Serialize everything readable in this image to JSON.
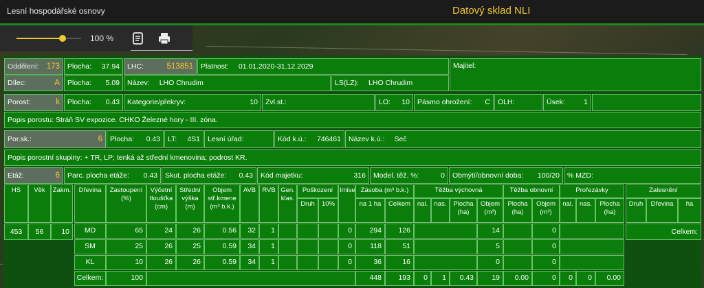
{
  "header": {
    "app_name": "Lesní hospodářské osnovy",
    "brand": "Datový sklad NLI"
  },
  "toolbar": {
    "zoom_percent": 100,
    "zoom_label": "100 %",
    "icons": [
      "notes-icon",
      "print-icon"
    ]
  },
  "colors": {
    "accent": "#f2c832",
    "panel_green": "#0a7d0a",
    "border": "#6cc26c",
    "grey_cell": "#5d6e5d"
  },
  "row1": {
    "oddeleni_label": "Oddělení:",
    "oddeleni_value": "173",
    "plocha_label": "Plocha:",
    "plocha_value": "37.94",
    "lhc_label": "LHC:",
    "lhc_value": "513851",
    "platnost_label": "Platnost:",
    "platnost_value": "01.01.2020-31.12.2029",
    "majitel_label": "Majitel:"
  },
  "row2": {
    "dilec_label": "Dílec:",
    "dilec_value": "A",
    "plocha_label": "Plocha:",
    "plocha_value": "5.09",
    "nazev_label": "Název:",
    "nazev_value": "LHO Chrudim",
    "ls_label": "LS(LZ):",
    "ls_value": "LHO Chrudim"
  },
  "row3": {
    "porost_label": "Porost:",
    "porost_value": "k",
    "plocha_label": "Plocha:",
    "plocha_value": "0.43",
    "kategorie_label": "Kategorie/překryv:",
    "kategorie_value": "10",
    "zvlst_label": "Zvl.st.:",
    "lo_label": "LO:",
    "lo_value": "10",
    "pasmo_label": "Pásmo ohrožení:",
    "pasmo_value": "C",
    "olh_label": "OLH:",
    "usek_label": "Úsek:",
    "usek_value": "1"
  },
  "row4": {
    "popis_label": "Popis porostu:",
    "popis_value": "Stráň SV expozice. CHKO Železné hory - III. zóna."
  },
  "row5": {
    "porsk_label": "Por.sk.:",
    "porsk_value": "6",
    "plocha_label": "Plocha:",
    "plocha_value": "0.43",
    "lt_label": "LT:",
    "lt_value": "4S1",
    "lesni_urad_label": "Lesní úřad:",
    "kod_ku_label": "Kód k.ú.:",
    "kod_ku_value": "746461",
    "nazev_ku_label": "Název k.ú.:",
    "nazev_ku_value": "Seč"
  },
  "row6": {
    "popis_label": "Popis porostní skupiny:",
    "popis_value": "+ TR, LP; tenká až střední kmenovina; podrost KR."
  },
  "row7": {
    "etaz_label": "Etáž:",
    "etaz_value": "6",
    "parc_label": "Parc. plocha etáže:",
    "parc_value": "0.43",
    "skut_label": "Skut. plocha etáže:",
    "skut_value": "0.43",
    "kod_majetku_label": "Kód majetku:",
    "kod_majetku_value": "316",
    "model_label": "Model. těž. %:",
    "model_value": "0",
    "obmyt_label": "Obmýtí/obnovní doba:",
    "obmyt_value": "100/20",
    "mzd_label": "% MZD:"
  },
  "left_table": {
    "headers": [
      "HS",
      "Věk",
      "Zakm."
    ],
    "values": [
      "453",
      "56",
      "10"
    ]
  },
  "species_table": {
    "headers": {
      "dreviny": "Dřevina",
      "zastoupeni": "Zastoupení (%)",
      "vycetni": "Výčetní tloušťka (cm)",
      "stredni": "Střední výška (m)",
      "objem": "Objem stř.kmene (m³ b.k.)",
      "avb": "AVB",
      "rvb": "RVB",
      "gen": "Gen. klas.",
      "poskozeni": "Poškození",
      "druh": "Druh",
      "p10": "10%",
      "imise": "Imise",
      "zasoba": "Zásoba (m³ b.k.)",
      "na1ha": "na 1 ha",
      "celkem": "Celkem",
      "tezba_vych": "Těžba výchovná",
      "nal": "nal.",
      "nas": "nas.",
      "plocha_ha": "Plocha (ha)",
      "objem_m3": "Objem (m³)",
      "tezba_obn": "Těžba obnovní",
      "prorezavky": "Prořezávky"
    },
    "rows": [
      {
        "drevina": "MD",
        "zastoupeni": "65",
        "vycetni": "24",
        "stredni": "26",
        "objem": "0.56",
        "avb": "32",
        "rvb": "1",
        "imise": "0",
        "na1ha": "294",
        "celkem": "126",
        "tv_objem": "14",
        "to_objem": "0"
      },
      {
        "drevina": "SM",
        "zastoupeni": "25",
        "vycetni": "26",
        "stredni": "25",
        "objem": "0.59",
        "avb": "34",
        "rvb": "1",
        "imise": "0",
        "na1ha": "118",
        "celkem": "51",
        "tv_objem": "5",
        "to_objem": "0"
      },
      {
        "drevina": "KL",
        "zastoupeni": "10",
        "vycetni": "26",
        "stredni": "26",
        "objem": "0.59",
        "avb": "34",
        "rvb": "1",
        "imise": "0",
        "na1ha": "36",
        "celkem": "16",
        "tv_objem": "0",
        "to_objem": "0"
      }
    ],
    "total": {
      "label": "Celkem:",
      "zastoupeni": "100",
      "na1ha": "448",
      "celkem": "193",
      "nal": "0",
      "nas": "1",
      "tv_plocha": "0.43",
      "tv_objem": "19",
      "to_plocha": "0.00",
      "to_objem": "0",
      "pr_nal": "0",
      "pr_nas": "0",
      "pr_plocha": "0.00"
    }
  },
  "zalesneni": {
    "title": "Zalesnění",
    "headers": [
      "Druh",
      "Dřevina",
      "ha"
    ],
    "celkem_label": "Celkem:"
  }
}
